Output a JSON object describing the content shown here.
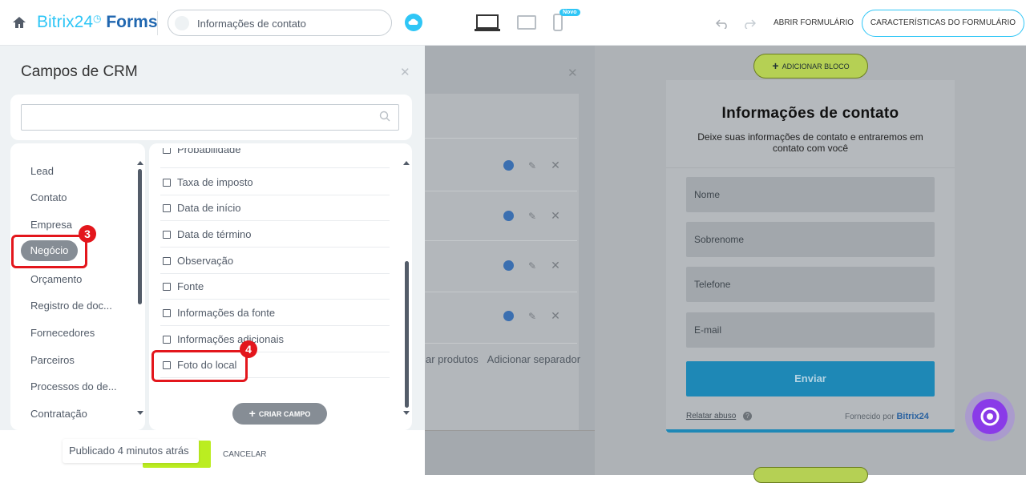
{
  "header": {
    "brand_prefix": "Bitrix24",
    "brand_suffix": "Forms",
    "form_name": "Informações de contato",
    "new_badge": "Novo",
    "open_form_label": "ABRIR FORMULÁRIO",
    "form_props_label": "CARACTERÍSTICAS DO FORMULÁRIO"
  },
  "crm_panel": {
    "title": "Campos de CRM",
    "search_value": "",
    "categories": [
      "Lead",
      "Contato",
      "Empresa",
      "Negócio",
      "Orçamento",
      "Registro de doc...",
      "Fornecedores",
      "Parceiros",
      "Processos do de...",
      "Contratação"
    ],
    "selected_category": "Negócio",
    "fields": [
      "Probabilidade",
      "Taxa de imposto",
      "Data de início",
      "Data de término",
      "Observação",
      "Fonte",
      "Informações da fonte",
      "Informações adicionais",
      "Foto do local"
    ],
    "create_field_label": "CRIAR CAMPO",
    "published_label": "Publicado 4 minutos atrás",
    "cancel_label": "CANCELAR"
  },
  "middle": {
    "link_products": "ar produtos",
    "link_separator": "Adicionar separador"
  },
  "preview": {
    "add_block_label": "ADICIONAR BLOCO",
    "title": "Informações de contato",
    "subtitle": "Deixe suas informações de contato e entraremos em contato com você",
    "fields": [
      "Nome",
      "Sobrenome",
      "Telefone",
      "E-mail"
    ],
    "submit_label": "Enviar",
    "abuse_label": "Relatar abuso",
    "powered_label": "Fornecido por",
    "powered_brand": "Bitrix24"
  },
  "annotations": {
    "step3": "3",
    "step4": "4"
  },
  "colors": {
    "accent": "#2fc6f6",
    "highlight": "#e3161c",
    "save_green": "#bbed21"
  }
}
